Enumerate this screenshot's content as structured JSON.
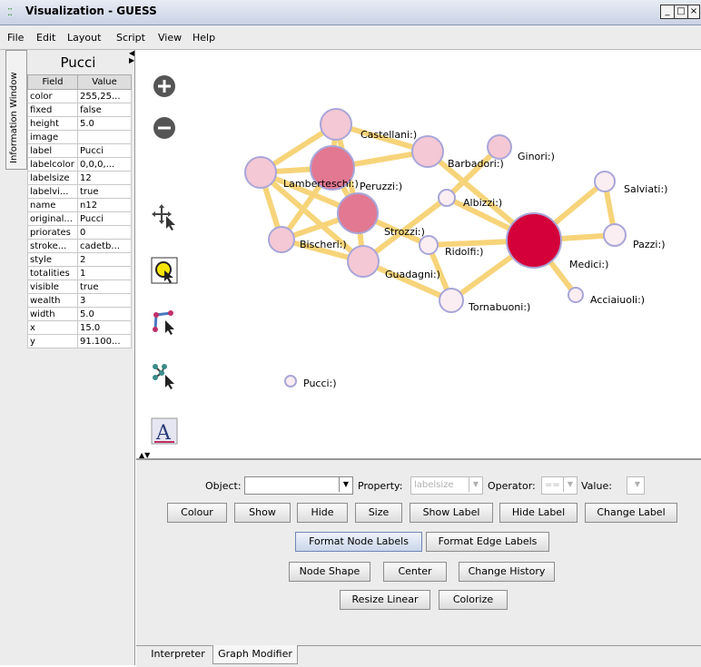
{
  "window": {
    "title": "Visualization - GUESS",
    "controls": [
      "_",
      "□",
      "×"
    ]
  },
  "menu": [
    "File",
    "Edit",
    "Layout",
    "Script",
    "View",
    "Help"
  ],
  "info_window": {
    "tab_label": "Information Window",
    "node_title": "Pucci",
    "columns": [
      "Field",
      "Value"
    ],
    "rows": [
      [
        "color",
        "255,25..."
      ],
      [
        "fixed",
        "false"
      ],
      [
        "height",
        "5.0"
      ],
      [
        "image",
        ""
      ],
      [
        "label",
        "Pucci"
      ],
      [
        "labelcolor",
        "0,0,0,..."
      ],
      [
        "labelsize",
        "12"
      ],
      [
        "labelvi...",
        "true"
      ],
      [
        "name",
        "n12"
      ],
      [
        "original...",
        "Pucci"
      ],
      [
        "priorates",
        "0"
      ],
      [
        "stroke...",
        "cadetb..."
      ],
      [
        "style",
        "2"
      ],
      [
        "totalities",
        "1"
      ],
      [
        "visible",
        "true"
      ],
      [
        "wealth",
        "3"
      ],
      [
        "width",
        "5.0"
      ],
      [
        "x",
        "15.0"
      ],
      [
        "y",
        "91.100..."
      ]
    ]
  },
  "graph": {
    "node_labels": {
      "castellani": "Castellani:)",
      "lamberteschi": "Lamberteschi:)",
      "peruzzi": "Peruzzi:)",
      "barbadori": "Barbadori:)",
      "ginori": "Ginori:)",
      "albizzi": "Albizzi:)",
      "salviati": "Salviati:)",
      "strozzi": "Strozzi:)",
      "bischeri": "Bischeri:)",
      "ridolfi": "Ridolfi:)",
      "medici": "Medici:)",
      "pazzi": "Pazzi:)",
      "guadagni": "Guadagni:)",
      "acciaiuoli": "Acciaiuoli:)",
      "tornabuoni": "Tornabuoni:)",
      "pucci": "Pucci:)"
    },
    "colors": {
      "edge": "#f7d47a",
      "node_stroke": "#a9a6d8",
      "node_light": "#f4c8d4",
      "node_mid": "#e27891",
      "node_dark": "#d4003a",
      "node_white": "#fbeef2"
    }
  },
  "tools": [
    "zoom-in-icon",
    "zoom-out-icon",
    "pan-icon",
    "select-icon",
    "edge-icon",
    "node-move-icon",
    "annotate-icon"
  ],
  "modifier": {
    "object_label": "Object:",
    "object_value": "",
    "property_label": "Property:",
    "property_value": "labelsize",
    "operator_label": "Operator:",
    "operator_value": "==",
    "value_label": "Value:",
    "value_value": "",
    "row1": [
      "Colour",
      "Show",
      "Hide",
      "Size",
      "Show Label",
      "Hide Label",
      "Change Label"
    ],
    "row2": [
      "Format Node Labels",
      "Format Edge Labels"
    ],
    "row3": [
      "Node Shape",
      "Center",
      "Change History"
    ],
    "row4": [
      "Resize Linear",
      "Colorize"
    ]
  },
  "bottom_tabs": [
    "Interpreter",
    "Graph Modifier"
  ]
}
